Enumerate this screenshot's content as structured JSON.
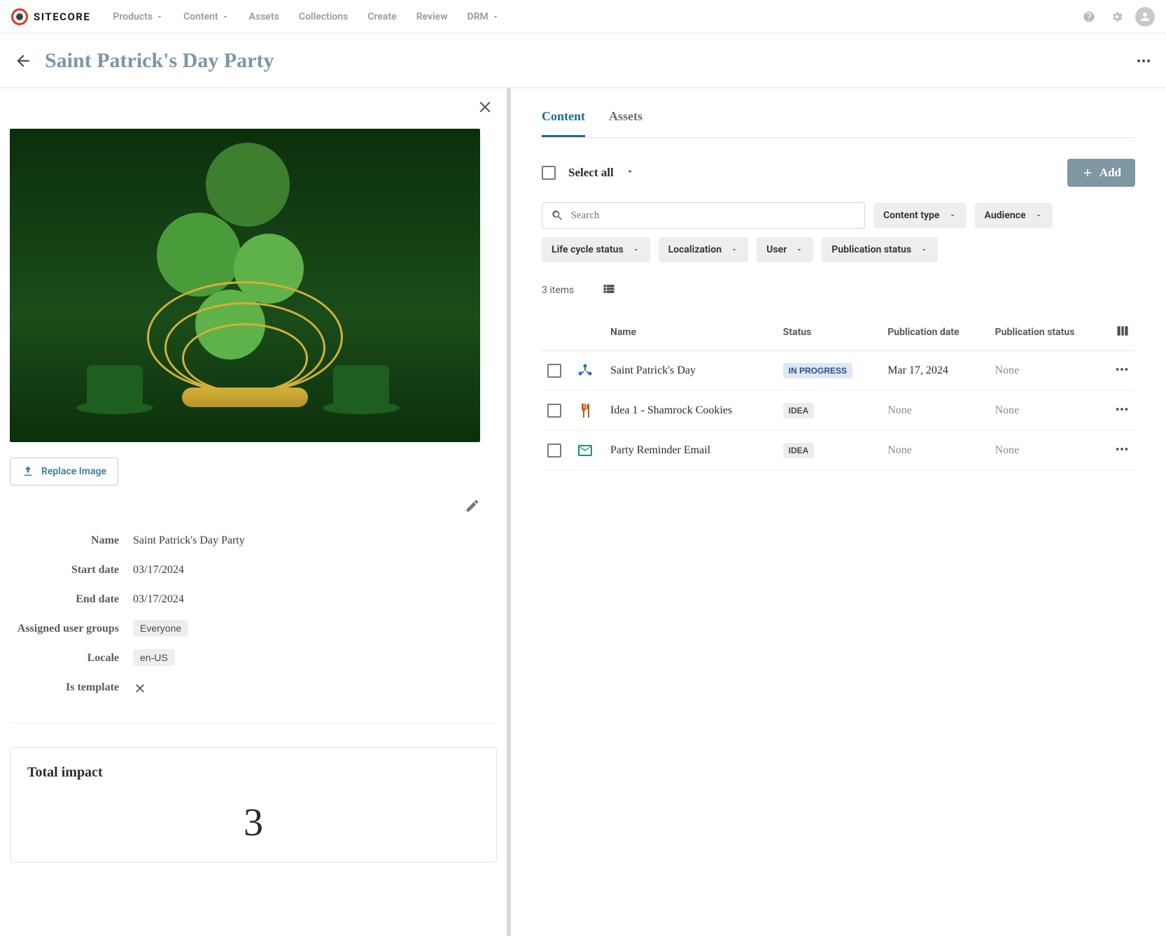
{
  "brand": "SITECORE",
  "nav": {
    "items": [
      "Products",
      "Content",
      "Assets",
      "Collections",
      "Create",
      "Review",
      "DRM"
    ],
    "dropdown_indices": [
      0,
      1,
      6
    ]
  },
  "page": {
    "title": "Saint Patrick's Day Party"
  },
  "left": {
    "replace_image_label": "Replace Image",
    "details": {
      "name_label": "Name",
      "name_value": "Saint Patrick's Day Party",
      "start_label": "Start date",
      "start_value": "03/17/2024",
      "end_label": "End date",
      "end_value": "03/17/2024",
      "groups_label": "Assigned user groups",
      "groups_value": "Everyone",
      "locale_label": "Locale",
      "locale_value": "en-US",
      "template_label": "Is template"
    },
    "impact": {
      "title": "Total impact",
      "value": "3"
    }
  },
  "right": {
    "tabs": {
      "content": "Content",
      "assets": "Assets"
    },
    "select_all": "Select all",
    "add_label": "Add",
    "search_placeholder": "Search",
    "filters": [
      "Content type",
      "Audience",
      "Life cycle status",
      "Localization",
      "User",
      "Publication status"
    ],
    "count_text": "3 items",
    "columns": {
      "name": "Name",
      "status": "Status",
      "pubdate": "Publication date",
      "pubstatus": "Publication status"
    },
    "rows": [
      {
        "name": "Saint Patrick's Day",
        "status": "IN PROGRESS",
        "status_kind": "inprogress",
        "pubdate": "Mar 17, 2024",
        "pubstatus": "None",
        "icon": "hub"
      },
      {
        "name": "Idea 1 - Shamrock Cookies",
        "status": "IDEA",
        "status_kind": "idea",
        "pubdate": "None",
        "pubstatus": "None",
        "icon": "food"
      },
      {
        "name": "Party Reminder Email",
        "status": "IDEA",
        "status_kind": "idea",
        "pubdate": "None",
        "pubstatus": "None",
        "icon": "email"
      }
    ]
  }
}
